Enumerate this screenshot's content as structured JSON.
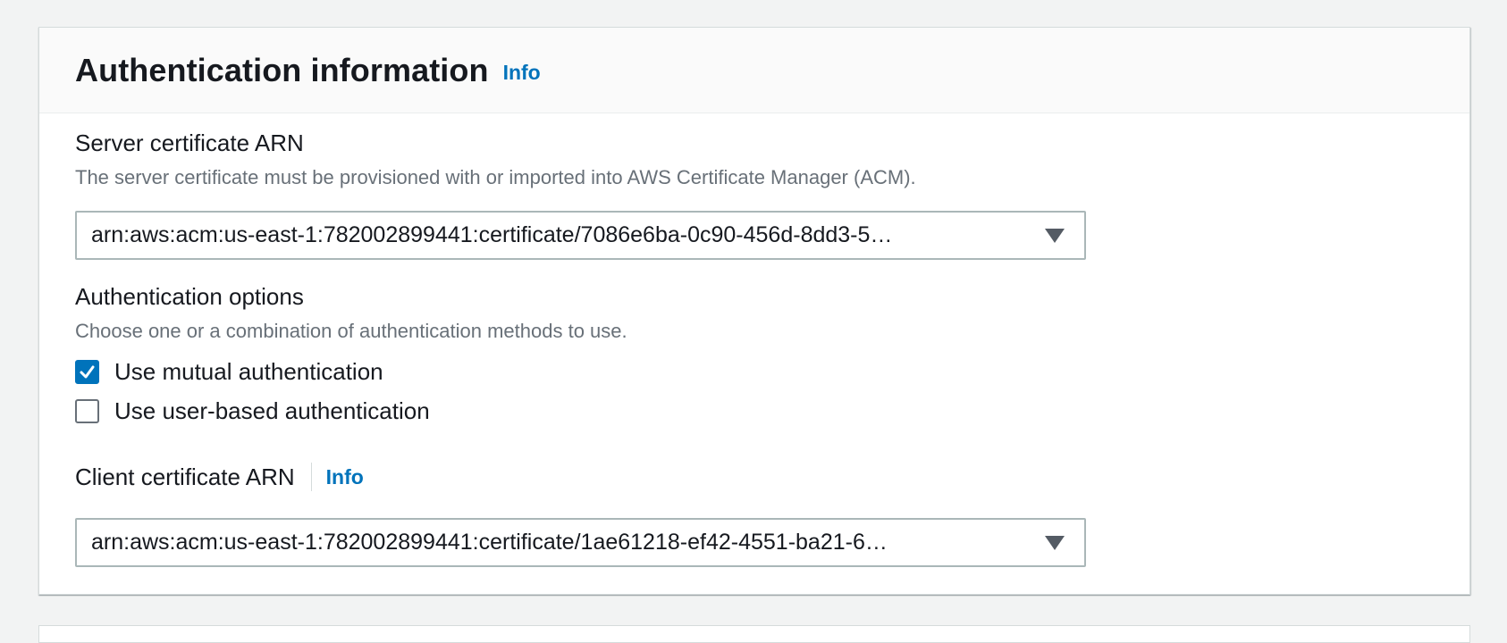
{
  "section": {
    "title": "Authentication information",
    "info_label": "Info"
  },
  "server_certificate": {
    "label": "Server certificate ARN",
    "description": "The server certificate must be provisioned with or imported into AWS Certificate Manager (ACM).",
    "value": "arn:aws:acm:us-east-1:782002899441:certificate/7086e6ba-0c90-456d-8dd3-5…"
  },
  "auth_options": {
    "label": "Authentication options",
    "description": "Choose one or a combination of authentication methods to use.",
    "options": [
      {
        "label": "Use mutual authentication",
        "checked": true
      },
      {
        "label": "Use user-based authentication",
        "checked": false
      }
    ]
  },
  "client_certificate": {
    "label": "Client certificate ARN",
    "info_label": "Info",
    "value": "arn:aws:acm:us-east-1:782002899441:certificate/1ae61218-ef42-4551-ba21-6…"
  },
  "colors": {
    "accent": "#0073bb",
    "text": "#16191f",
    "muted": "#687078",
    "border": "#aab7b8",
    "background": "#f2f3f3"
  }
}
